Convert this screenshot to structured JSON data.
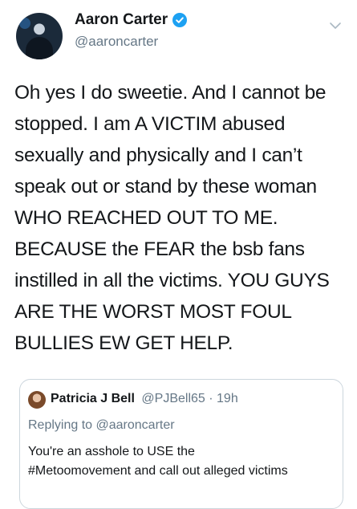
{
  "author": {
    "display_name": "Aaron Carter",
    "handle": "@aaroncarter",
    "verified": true,
    "verified_color": "#1da1f2"
  },
  "menu_icon": "chevron-down-icon",
  "tweet": {
    "text": "Oh yes I do sweetie. And I cannot be\nstopped. I am A VICTIM abused\nsexually and physically and I can’t\nspeak out or stand by these woman\nWHO REACHED OUT TO ME.\nBECAUSE the FEAR the bsb fans\ninstilled in all the victims. YOU GUYS\nARE THE WORST MOST FOUL\nBULLIES EW GET HELP."
  },
  "quoted_tweet": {
    "display_name": "Patricia J Bell",
    "handle_time": "@PJBell65 · 19h",
    "replying_prefix": "Replying to",
    "replying_to": "@aaroncarter",
    "text": "You're an asshole to USE the\n#Metoomovement and call out alleged victims"
  },
  "colors": {
    "text": "#14171a",
    "secondary": "#657786",
    "border": "#ccd6dd"
  }
}
